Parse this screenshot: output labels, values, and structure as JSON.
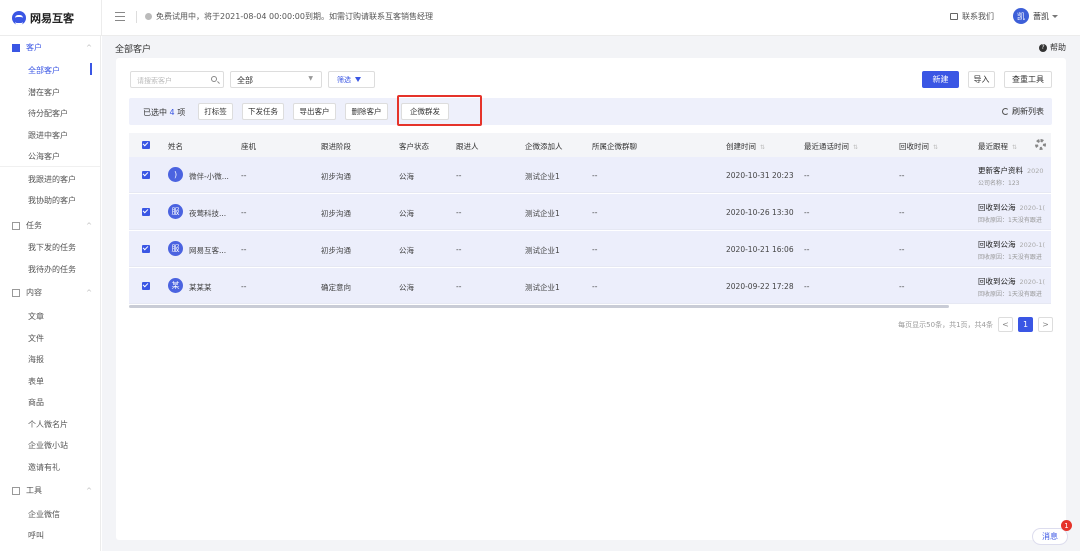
{
  "app": {
    "name": "网易互客"
  },
  "topbar": {
    "notice": "免费试用中，将于2021-08-04 00:00:00到期。如需订购请联系互客销售经理",
    "contact": "联系我们",
    "user_avatar": "凯",
    "user_name": "蔷凯"
  },
  "sidebar": {
    "groups": {
      "customer": "客户",
      "task": "任务",
      "content": "内容",
      "tools": "工具"
    },
    "customer_items": [
      "全部客户",
      "潜在客户",
      "待分配客户",
      "跟进中客户",
      "公海客户",
      "我跟进的客户",
      "我协助的客户"
    ],
    "task_items": [
      "我下发的任务",
      "我待办的任务"
    ],
    "content_items": [
      "文章",
      "文件",
      "海报",
      "表单",
      "商品",
      "个人微名片",
      "企业微小站",
      "邀请有礼"
    ],
    "tools_items": [
      "企业微信",
      "呼叫"
    ]
  },
  "main": {
    "page_title": "全部客户",
    "help": "帮助",
    "search_placeholder": "请搜索客户",
    "filter_value": "全部",
    "filter_button": "筛选",
    "new_button": "新建",
    "import_button": "导入",
    "dedupe_button": "查重工具"
  },
  "bulk": {
    "selected_prefix": "已选中",
    "selected_count": "4",
    "selected_suffix": "项",
    "buttons": [
      "打标签",
      "下发任务",
      "导出客户",
      "删除客户",
      "企微群发"
    ],
    "refresh": "刷新列表"
  },
  "table": {
    "headers": [
      "姓名",
      "座机",
      "跟进阶段",
      "客户状态",
      "跟进人",
      "企微添加人",
      "所属企微群聊",
      "创建时间",
      "最近通话时间",
      "回收时间",
      "最近跟程"
    ],
    "rows": [
      {
        "avatar": ")",
        "name": "微伴-小微...",
        "phone": "--",
        "stage": "初步沟通",
        "status": "公海",
        "owner": "--",
        "adder": "测试企业1",
        "group": "--",
        "created": "2020-10-31 20:23",
        "last_call": "--",
        "recycled": "--",
        "activity_title": "更新客户资料",
        "activity_time": "2020",
        "activity_sub": "公司名称：123"
      },
      {
        "avatar": "服",
        "name": "夜莺科技...",
        "phone": "--",
        "stage": "初步沟通",
        "status": "公海",
        "owner": "--",
        "adder": "测试企业1",
        "group": "--",
        "created": "2020-10-26 13:30",
        "last_call": "--",
        "recycled": "--",
        "activity_title": "回收到公海",
        "activity_time": "2020-1(",
        "activity_sub": "回收原因：1天没有跟进"
      },
      {
        "avatar": "服",
        "name": "网易互客...",
        "phone": "--",
        "stage": "初步沟通",
        "status": "公海",
        "owner": "--",
        "adder": "测试企业1",
        "group": "--",
        "created": "2020-10-21 16:06",
        "last_call": "--",
        "recycled": "--",
        "activity_title": "回收到公海",
        "activity_time": "2020-1(",
        "activity_sub": "回收原因：1天没有跟进"
      },
      {
        "avatar": "某",
        "name": "某某某",
        "phone": "--",
        "stage": "确定意向",
        "status": "公海",
        "owner": "--",
        "adder": "测试企业1",
        "group": "--",
        "created": "2020-09-22 17:28",
        "last_call": "--",
        "recycled": "--",
        "activity_title": "回收到公海",
        "activity_time": "2020-1(",
        "activity_sub": "回收原因：1天没有跟进"
      }
    ]
  },
  "pager": {
    "summary": "每页显示50条，共1页，共4条",
    "prev": "<",
    "current_page": "1",
    "next": ">"
  },
  "messages": {
    "label": "消息",
    "badge": "1"
  },
  "colors": {
    "brand": "#3a56e4",
    "highlight": "#e5332a"
  }
}
